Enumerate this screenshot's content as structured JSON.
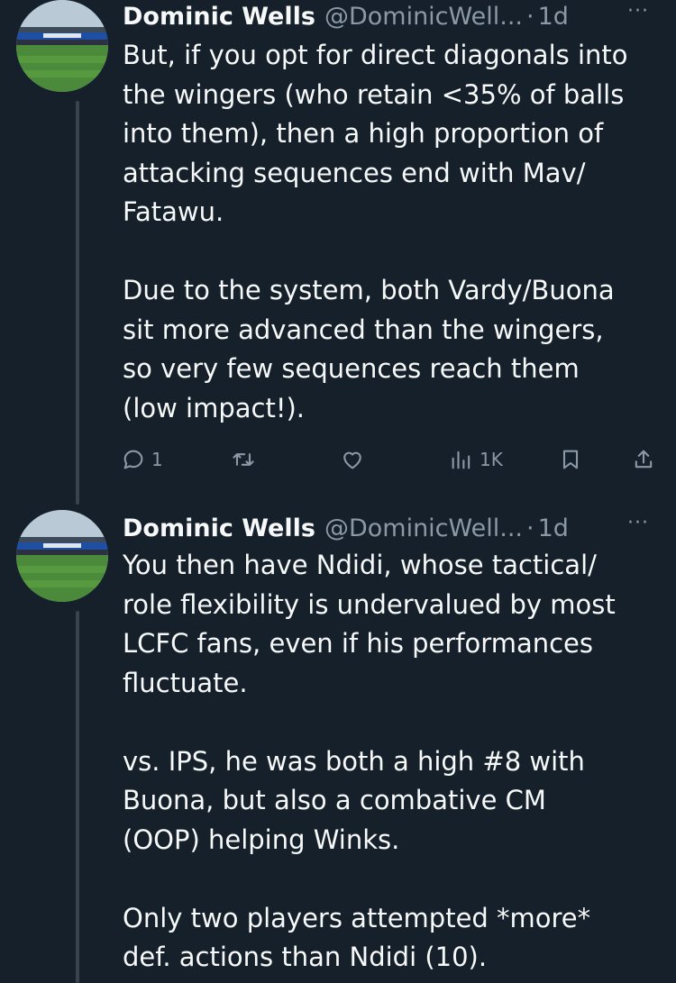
{
  "tweets": [
    {
      "author_name": "Dominic Wells",
      "handle": "@DominicWell...",
      "separator": "·",
      "time": "1d",
      "more": "···",
      "paragraphs": [
        "But, if you opt for direct diagonals into\nthe wingers (who retain <35% of balls\ninto them), then a high proportion of\nattacking sequences end with Mav/\nFatawu.",
        "Due to the system, both Vardy/Buona\nsit more advanced than the wingers,\nso very few sequences reach them\n(low impact!)."
      ],
      "actions": {
        "reply_count": "1",
        "views_count": "1K"
      }
    },
    {
      "author_name": "Dominic Wells",
      "handle": "@DominicWell...",
      "separator": "·",
      "time": "1d",
      "more": "···",
      "paragraphs": [
        "You then have Ndidi, whose tactical/\nrole flexibility is undervalued by most\nLCFC fans, even if his performances\nfluctuate.",
        "vs. IPS, he was both a high #8 with\nBuona, but also a combative CM\n(OOP) helping Winks.",
        "Only two players attempted *more*\ndef. actions than Ndidi (10)."
      ]
    }
  ],
  "icons": [
    "reply-icon",
    "retweet-icon",
    "like-icon",
    "views-icon",
    "bookmark-icon",
    "share-icon"
  ],
  "colors": {
    "background": "#15202b",
    "primary_text": "#f7f9f9",
    "secondary_text": "#8b98a5",
    "thread_line": "#38444d"
  }
}
